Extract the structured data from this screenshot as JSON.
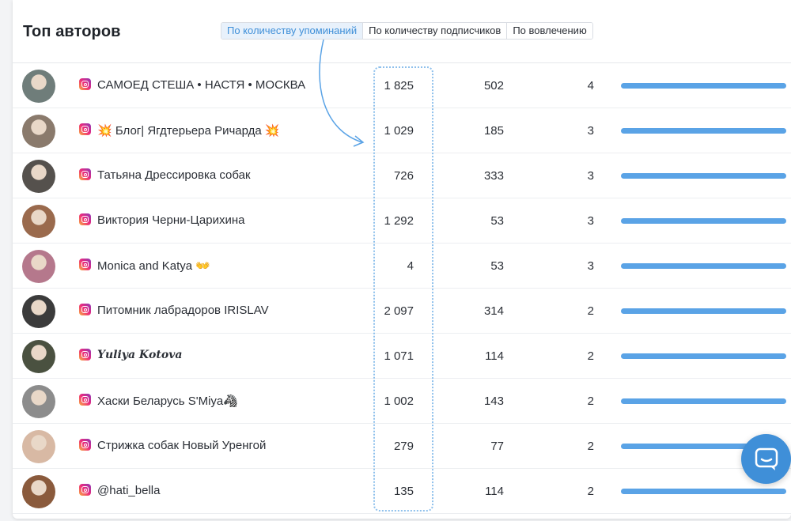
{
  "title": "Топ авторов",
  "tabs": [
    {
      "label": "По количеству упоминаний",
      "active": true
    },
    {
      "label": "По количеству подписчиков",
      "active": false
    },
    {
      "label": "По вовлечению",
      "active": false
    }
  ],
  "rows": [
    {
      "name": "САМОЕД СТЕША • НАСТЯ • МОСКВА",
      "mentions": "1 825",
      "followers": "502",
      "engagement": "4",
      "bar": 1.0,
      "avatar_color": "#6f7d7a"
    },
    {
      "name": "💥 Блог| Ягдтерьера Ричарда 💥",
      "mentions": "1 029",
      "followers": "185",
      "engagement": "3",
      "bar": 1.0,
      "avatar_color": "#8a7a6c"
    },
    {
      "name": "Татьяна Дрессировка собак",
      "mentions": "726",
      "followers": "333",
      "engagement": "3",
      "bar": 1.0,
      "avatar_color": "#55514d"
    },
    {
      "name": "Виктория Черни-Царихина",
      "mentions": "1 292",
      "followers": "53",
      "engagement": "3",
      "bar": 1.0,
      "avatar_color": "#9a6a4d"
    },
    {
      "name": "Monica and Katya 👐",
      "mentions": "4",
      "followers": "53",
      "engagement": "3",
      "bar": 1.0,
      "avatar_color": "#b5788c"
    },
    {
      "name": "Питомник лабрадоров IRISLAV",
      "mentions": "2 097",
      "followers": "314",
      "engagement": "2",
      "bar": 1.0,
      "avatar_color": "#3b3b3b"
    },
    {
      "name": "𝒀𝒖𝒍𝒊𝒚𝒂 𝑲𝒐𝒕𝒐𝒗𝒂",
      "mentions": "1 071",
      "followers": "114",
      "engagement": "2",
      "bar": 1.0,
      "avatar_color": "#4a5140"
    },
    {
      "name": "Хаски Беларусь S'Miya🦓",
      "mentions": "1 002",
      "followers": "143",
      "engagement": "2",
      "bar": 1.0,
      "avatar_color": "#8c8c8c"
    },
    {
      "name": "Стрижка собак Новый Уренгой",
      "mentions": "279",
      "followers": "77",
      "engagement": "2",
      "bar": 1.0,
      "avatar_color": "#d8b9a4"
    },
    {
      "name": "@hati_bella",
      "mentions": "135",
      "followers": "114",
      "engagement": "2",
      "bar": 1.0,
      "avatar_color": "#8a5a3c"
    }
  ],
  "colors": {
    "accent": "#3f8fd8",
    "bar": "#5aa3e6",
    "highlight": "#8ec0ec"
  },
  "icons": {
    "platform": "instagram-icon",
    "chat": "chat-icon"
  }
}
